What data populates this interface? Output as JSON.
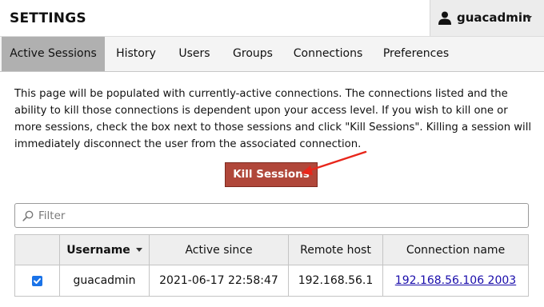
{
  "header": {
    "title": "SETTINGS",
    "username": "guacadmin"
  },
  "tabs": [
    {
      "label": "Active Sessions",
      "active": true
    },
    {
      "label": "History"
    },
    {
      "label": "Users"
    },
    {
      "label": "Groups"
    },
    {
      "label": "Connections"
    },
    {
      "label": "Preferences"
    }
  ],
  "main": {
    "description": "This page will be populated with currently-active connections. The connections listed and the ability to kill those connections is dependent upon your access level. If you wish to kill one or more sessions, check the box next to those sessions and click \"Kill Sessions\". Killing a session will immediately disconnect the user from the associated connection.",
    "kill_button_label": "Kill Sessions",
    "filter_placeholder": "Filter"
  },
  "table": {
    "headers": {
      "username": "Username",
      "active_since": "Active since",
      "remote_host": "Remote host",
      "connection_name": "Connection name"
    },
    "rows": [
      {
        "checked": true,
        "username": "guacadmin",
        "active_since": "2021-06-17 22:58:47",
        "remote_host": "192.168.56.1",
        "connection_name": "192.168.56.106 2003"
      }
    ]
  },
  "colors": {
    "kill_button": "#b0473a",
    "active_tab": "#b0b0b0",
    "annotation_arrow": "#e8261b",
    "link": "#1a0dab",
    "checkbox": "#1a73e8"
  },
  "icons": {
    "user": "user-icon",
    "search": "search-icon",
    "caret": "chevron-down-icon",
    "check": "checkmark-icon"
  }
}
